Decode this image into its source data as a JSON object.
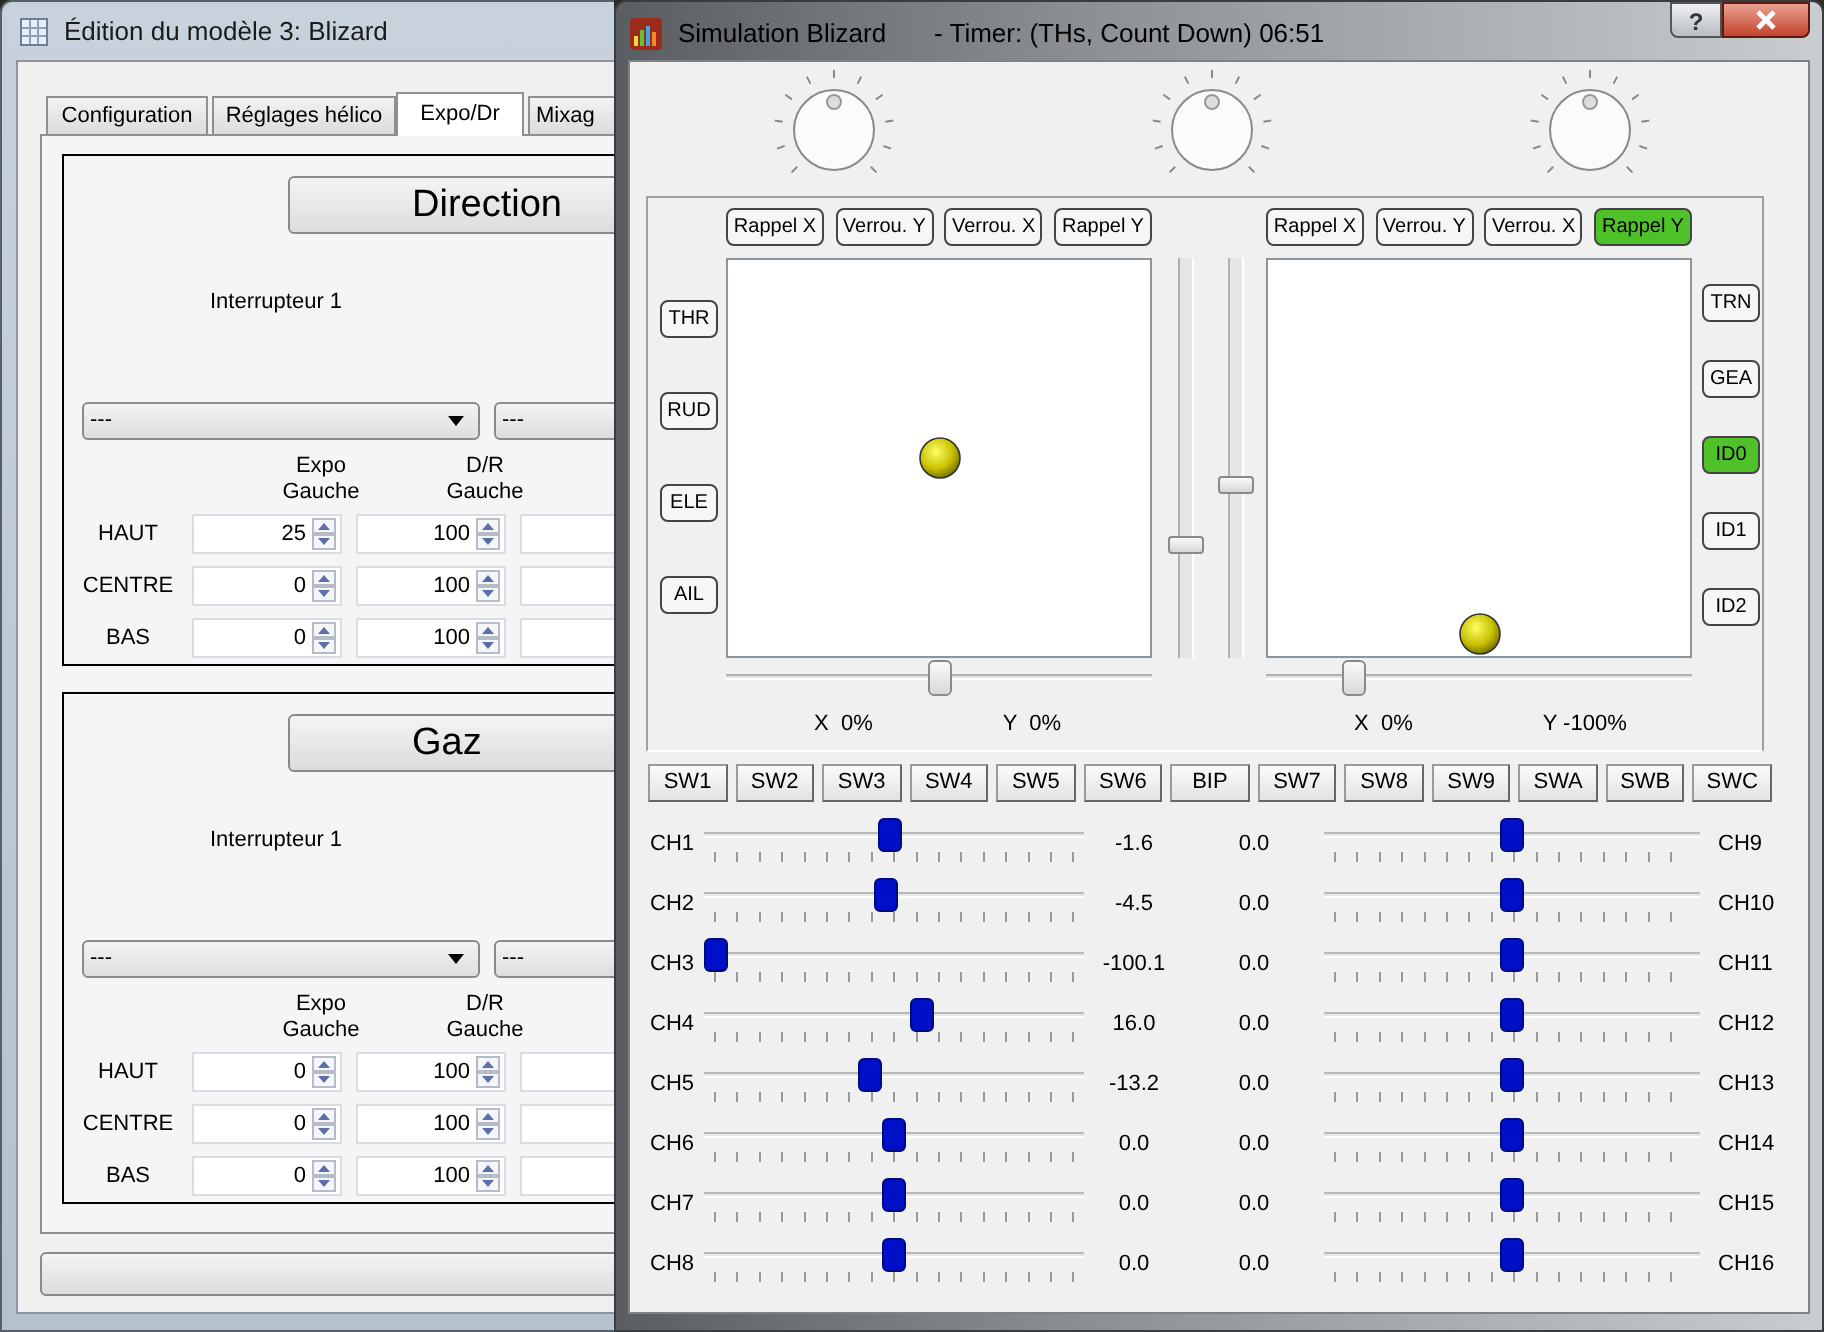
{
  "editor_window": {
    "title": "Édition du modèle 3: Blizard",
    "tabs": [
      {
        "label": "Configuration",
        "selected": false
      },
      {
        "label": "Réglages hélico",
        "selected": false
      },
      {
        "label": "Expo/Dr",
        "selected": true
      },
      {
        "label": "Mixag",
        "selected": false
      }
    ],
    "sections": [
      {
        "title": "Direction",
        "switch_label": "Interrupteur 1",
        "combos": [
          "---",
          "---"
        ],
        "columns": [
          "Expo\nGauche",
          "D/R\nGauche"
        ],
        "rows": [
          {
            "label": "HAUT",
            "values": [
              "25",
              "100"
            ]
          },
          {
            "label": "CENTRE",
            "values": [
              "0",
              "100"
            ]
          },
          {
            "label": "BAS",
            "values": [
              "0",
              "100"
            ]
          }
        ]
      },
      {
        "title": "Gaz",
        "switch_label": "Interrupteur 1",
        "combos": [
          "---",
          "---"
        ],
        "columns": [
          "Expo\nGauche",
          "D/R\nGauche"
        ],
        "rows": [
          {
            "label": "HAUT",
            "values": [
              "0",
              "100"
            ]
          },
          {
            "label": "CENTRE",
            "values": [
              "0",
              "100"
            ]
          },
          {
            "label": "BAS",
            "values": [
              "0",
              "100"
            ]
          }
        ]
      }
    ]
  },
  "simulator_window": {
    "title": "Simulation Blizard",
    "timer": "- Timer: (THs, Count Down) 06:51",
    "help": "?",
    "knobs": [
      {
        "level": 0.5
      },
      {
        "level": 0.5
      },
      {
        "level": 0.5
      }
    ],
    "left_switches": [
      {
        "label": "THR",
        "on": false
      },
      {
        "label": "RUD",
        "on": false
      },
      {
        "label": "ELE",
        "on": false
      },
      {
        "label": "AIL",
        "on": false
      }
    ],
    "right_switches": [
      {
        "label": "TRN",
        "on": false
      },
      {
        "label": "GEA",
        "on": false
      },
      {
        "label": "ID0",
        "on": true
      },
      {
        "label": "ID1",
        "on": false
      },
      {
        "label": "ID2",
        "on": false
      }
    ],
    "sticks": [
      {
        "toggles": [
          {
            "label": "Rappel X",
            "on": false
          },
          {
            "label": "Verrou. Y",
            "on": false
          },
          {
            "label": "Verrou. X",
            "on": false
          },
          {
            "label": "Rappel Y",
            "on": false
          }
        ],
        "horizontal": {
          "level": 0.5
        },
        "vertical": {
          "level": 0.5
        },
        "trim": {
          "level": 0.5
        },
        "x_reading": "X  0%",
        "y_reading": "Y  0%"
      },
      {
        "toggles": [
          {
            "label": "Rappel X",
            "on": false
          },
          {
            "label": "Verrou. Y",
            "on": false
          },
          {
            "label": "Verrou. X",
            "on": false
          },
          {
            "label": "Rappel Y",
            "on": true
          }
        ],
        "horizontal": {
          "level": 0.5
        },
        "vertical": {
          "level": 0
        },
        "trim": {
          "level": 0.19
        },
        "x_reading": "X  0%",
        "y_reading": "Y -100%"
      }
    ],
    "vertical_sliders": [
      {
        "level": 0.27
      },
      {
        "level": 0.43
      }
    ],
    "switch_buttons": [
      "SW1",
      "SW2",
      "SW3",
      "SW4",
      "SW5",
      "SW6",
      "BIP",
      "SW7",
      "SW8",
      "SW9",
      "SWA",
      "SWB",
      "SWC"
    ],
    "channels_left": [
      {
        "name": "CH1",
        "value": "-1.6",
        "level": 0.49
      },
      {
        "name": "CH2",
        "value": "-4.5",
        "level": 0.48
      },
      {
        "name": "CH3",
        "value": "-100.1",
        "level": 0
      },
      {
        "name": "CH4",
        "value": "16.0",
        "level": 0.58
      },
      {
        "name": "CH5",
        "value": "-13.2",
        "level": 0.43
      },
      {
        "name": "CH6",
        "value": "0.0",
        "level": 0.5
      },
      {
        "name": "CH7",
        "value": "0.0",
        "level": 0.5
      },
      {
        "name": "CH8",
        "value": "0.0",
        "level": 0.5
      }
    ],
    "channels_right": [
      {
        "name": "CH9",
        "value": "0.0",
        "level": 0.5
      },
      {
        "name": "CH10",
        "value": "0.0",
        "level": 0.5
      },
      {
        "name": "CH11",
        "value": "0.0",
        "level": 0.5
      },
      {
        "name": "CH12",
        "value": "0.0",
        "level": 0.5
      },
      {
        "name": "CH13",
        "value": "0.0",
        "level": 0.5
      },
      {
        "name": "CH14",
        "value": "0.0",
        "level": 0.5
      },
      {
        "name": "CH15",
        "value": "0.0",
        "level": 0.5
      },
      {
        "name": "CH16",
        "value": "0.0",
        "level": 0.5
      }
    ]
  }
}
